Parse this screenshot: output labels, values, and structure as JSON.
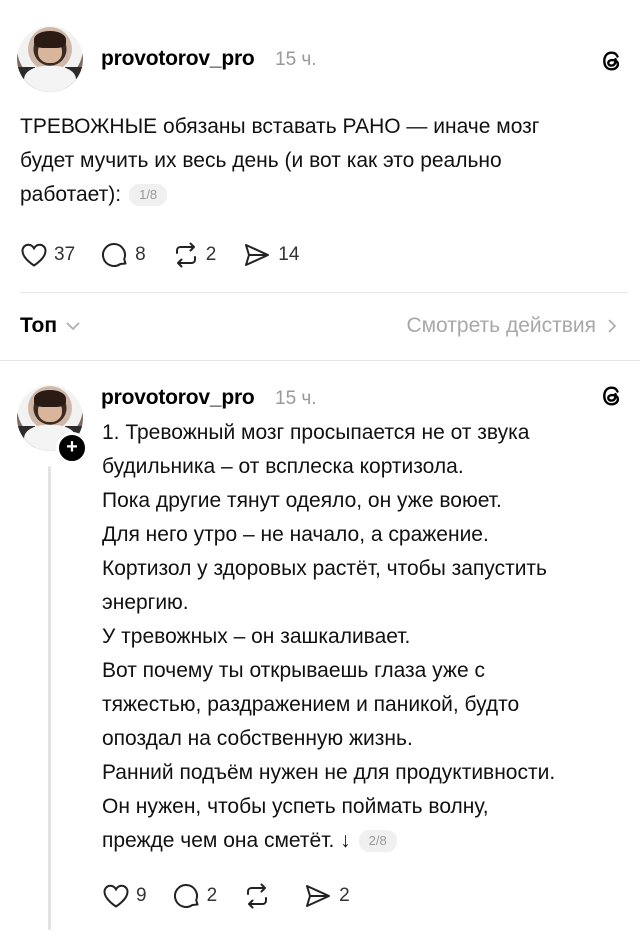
{
  "post": {
    "username": "provotorov_pro",
    "time": "15 ч.",
    "text_lines": [
      "ТРЕВОЖНЫЕ обязаны вставать РАНО — иначе мозг",
      "будет мучить их весь день (и вот как это реально",
      "работает):"
    ],
    "pager": "1/8",
    "likes": "37",
    "comments": "8",
    "reposts": "2",
    "shares": "14"
  },
  "sort": {
    "label": "Топ",
    "view_actions": "Смотреть действия"
  },
  "reply": {
    "username": "provotorov_pro",
    "time": "15 ч.",
    "lines": [
      "1. Тревожный мозг просыпается не от звука",
      "будильника – от всплеска кортизола.",
      "Пока другие тянут одеяло, он уже воюет.",
      "Для него утро – не начало, а сражение.",
      "Кортизол у здоровых растёт, чтобы запустить",
      "энергию.",
      "У тревожных – он зашкаливает.",
      "Вот почему ты открываешь глаза уже с",
      "тяжестью, раздражением и паникой, будто",
      "опоздал на собственную жизнь.",
      "Ранний подъём нужен не для продуктивности.",
      "Он нужен, чтобы успеть поймать волну,",
      "прежде чем она сметёт. ↓"
    ],
    "pager": "2/8",
    "likes": "9",
    "comments": "2",
    "reposts": "",
    "shares": "2"
  },
  "icons": {
    "threads": "threads-logo-icon",
    "like": "heart-icon",
    "comment": "comment-bubble-icon",
    "repost": "repost-arrows-icon",
    "share": "paper-plane-icon",
    "follow": "plus-icon"
  }
}
